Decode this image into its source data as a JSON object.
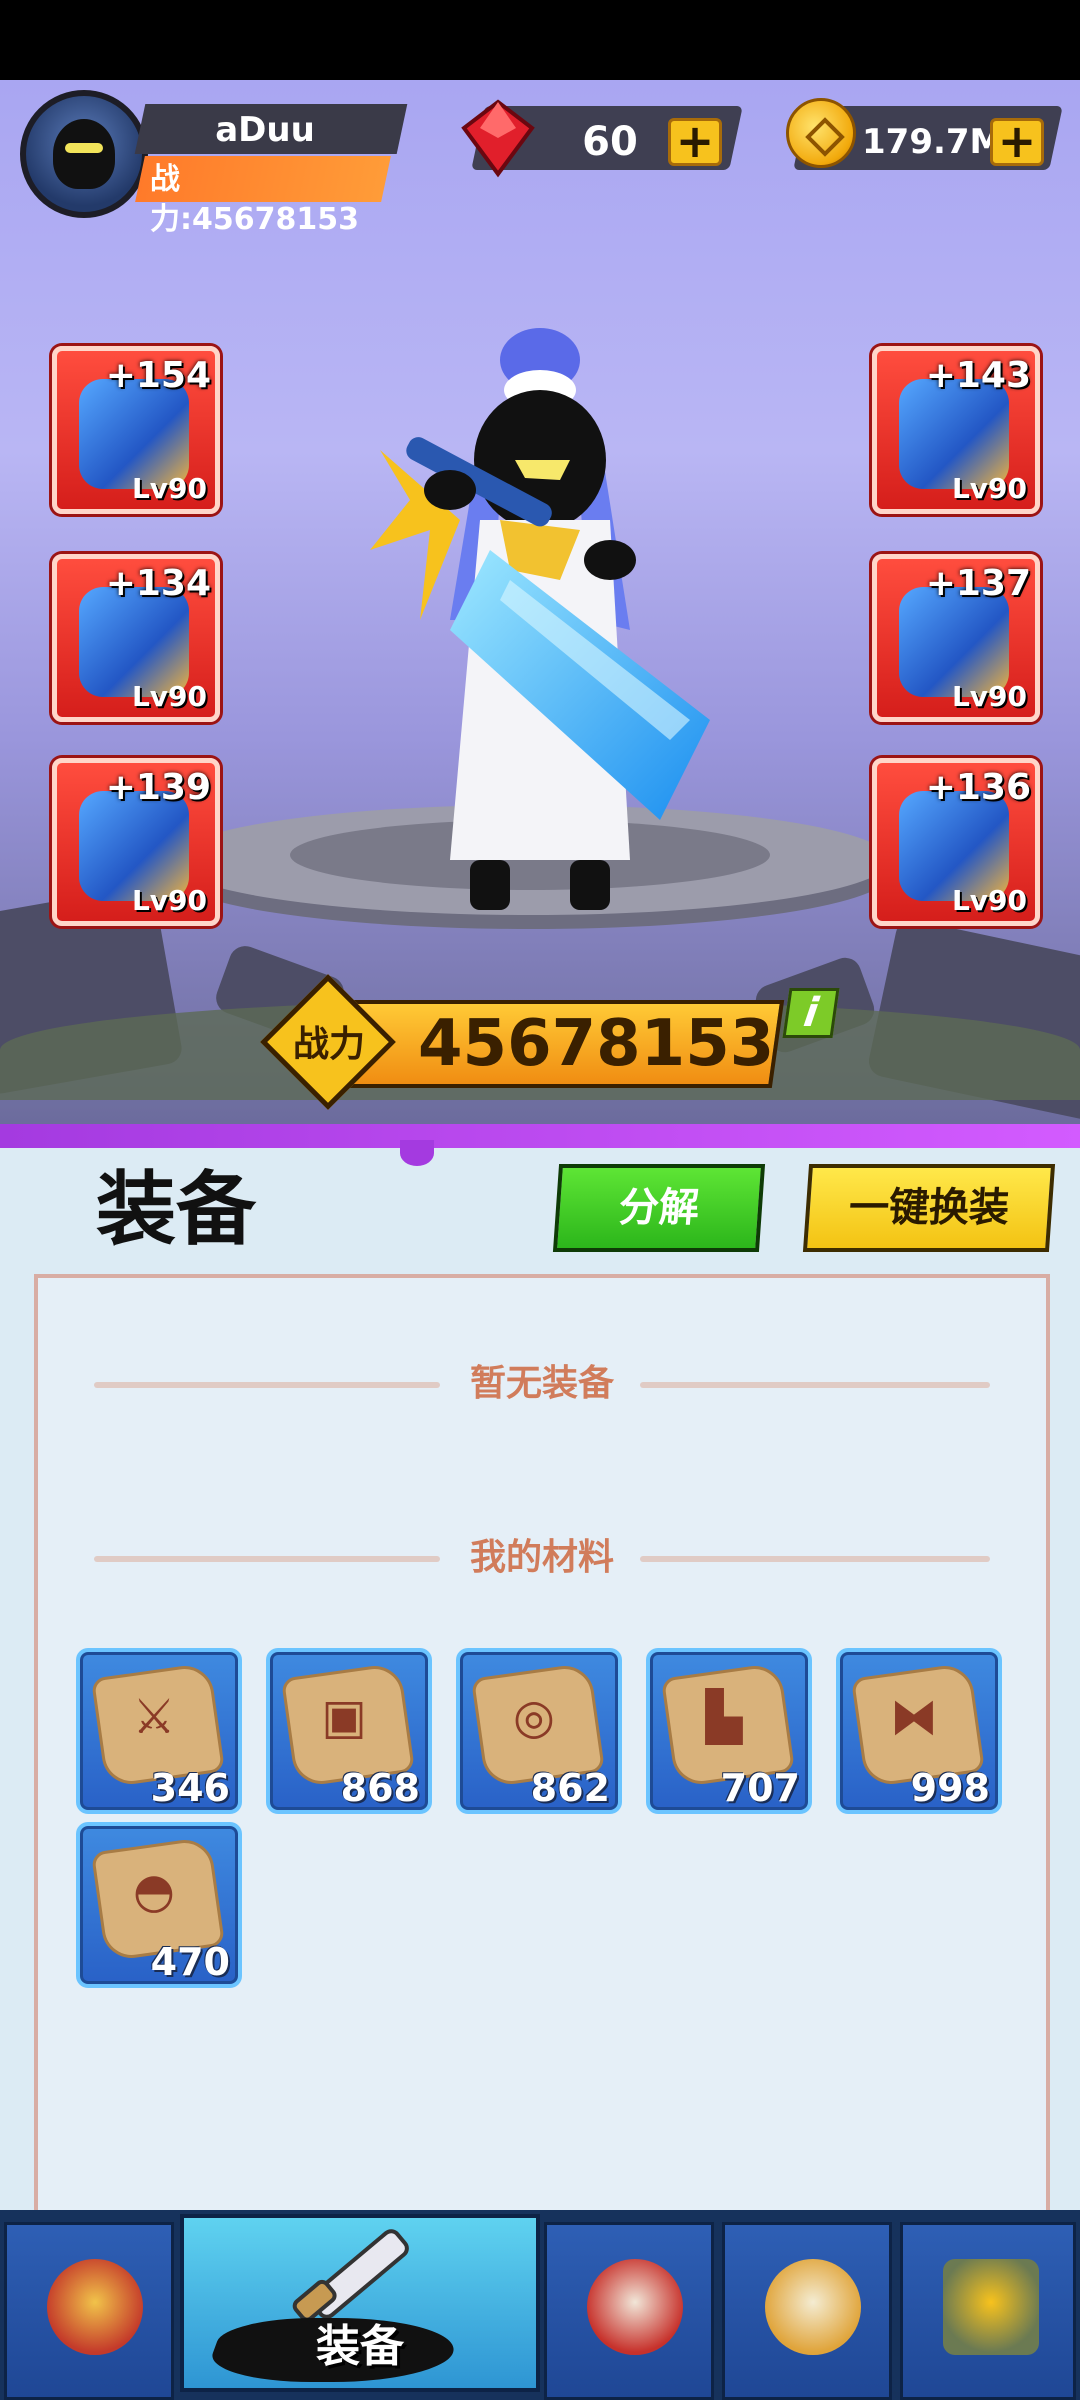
{
  "player": {
    "name": "aDuu",
    "power_label": "战力:45678153"
  },
  "resources": {
    "gems": "60",
    "gold": "179.7M",
    "plus": "+"
  },
  "slots": {
    "left": [
      {
        "plus": "+154",
        "level": "Lv90"
      },
      {
        "plus": "+134",
        "level": "Lv90"
      },
      {
        "plus": "+139",
        "level": "Lv90"
      }
    ],
    "right": [
      {
        "plus": "+143",
        "level": "Lv90"
      },
      {
        "plus": "+137",
        "level": "Lv90"
      },
      {
        "plus": "+136",
        "level": "Lv90"
      }
    ]
  },
  "combat": {
    "label": "战力",
    "value": "45678153",
    "info": "i"
  },
  "panel": {
    "title": "装备",
    "decompose_button": "分解",
    "equip_all_button": "一键换装",
    "empty_text": "暂无装备",
    "materials_title": "我的材料"
  },
  "materials": [
    {
      "icon": "sword-scroll-icon",
      "count": "346"
    },
    {
      "icon": "armor-scroll-icon",
      "count": "868"
    },
    {
      "icon": "ring-scroll-icon",
      "count": "862"
    },
    {
      "icon": "boots-scroll-icon",
      "count": "707"
    },
    {
      "icon": "belt-scroll-icon",
      "count": "998"
    },
    {
      "icon": "hat-scroll-icon",
      "count": "470"
    }
  ],
  "nav": {
    "active_label": "装备",
    "items": [
      "hero-icon",
      "equipment-icon",
      "battle-drum-icon",
      "scroll-map-icon",
      "guild-gate-icon"
    ]
  },
  "colors": {
    "slot_red": "#d51e1b",
    "power_orange": "#f08d12",
    "decompose_green": "#2cb61b",
    "equip_yellow": "#f3c313",
    "panel_bg": "#dcebf4",
    "accent_purple": "#a43ae0"
  }
}
